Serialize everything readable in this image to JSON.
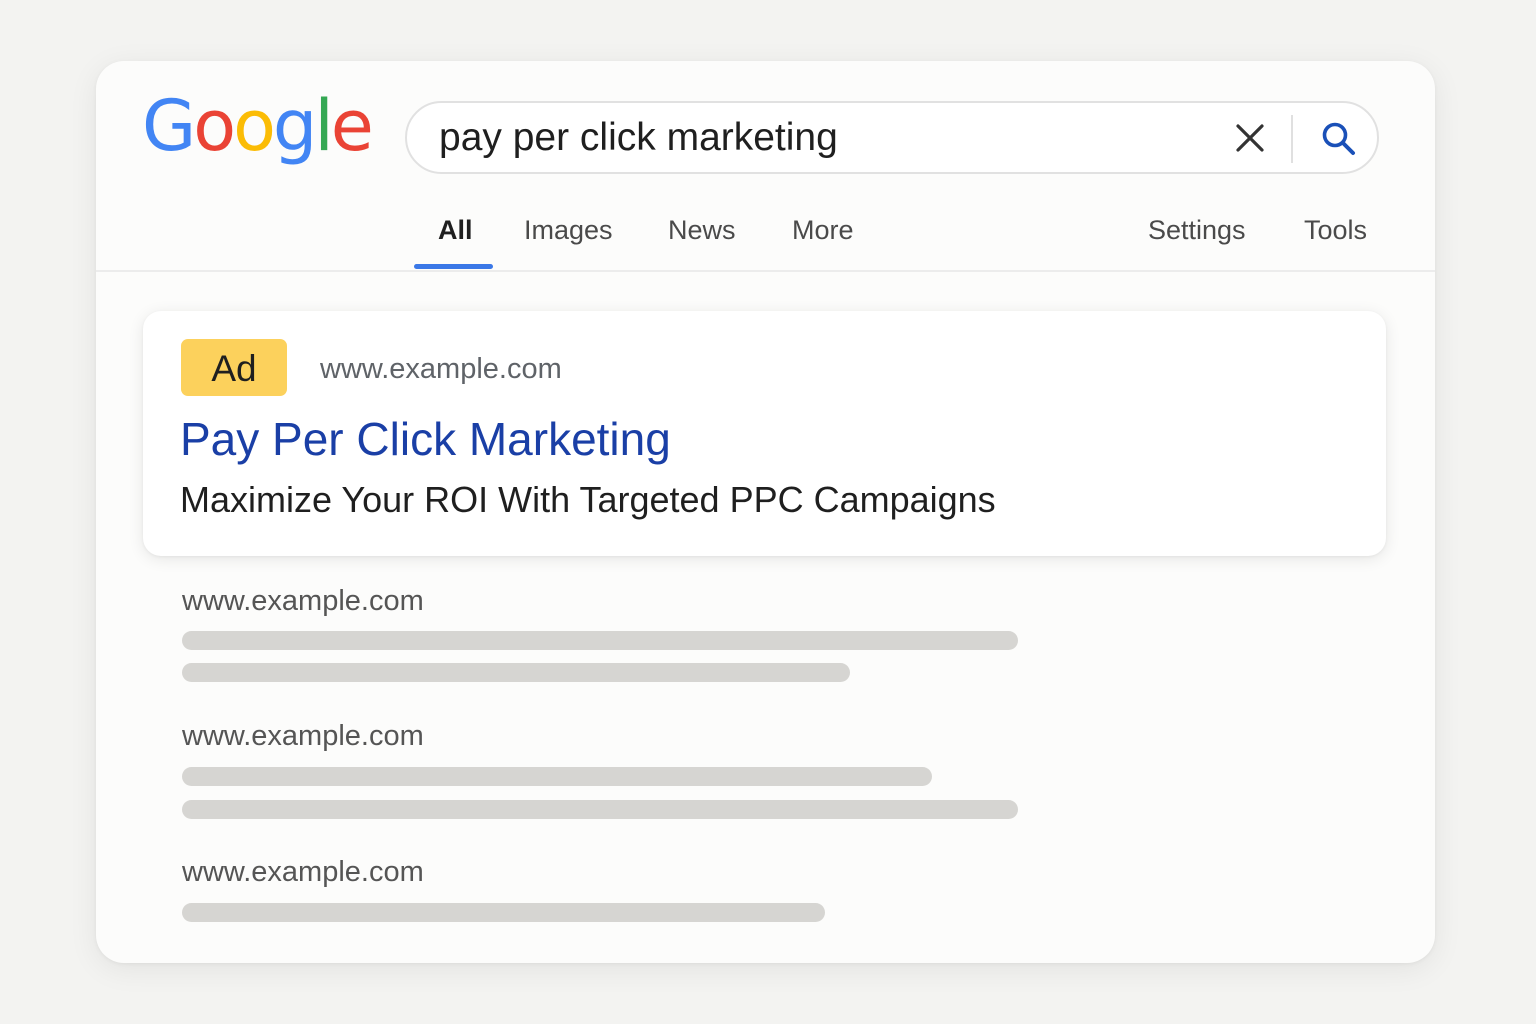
{
  "logo": {
    "letters": [
      "G",
      "o",
      "o",
      "g",
      "l",
      "e"
    ],
    "colors": [
      "#4285F4",
      "#EA4335",
      "#FBBC05",
      "#4285F4",
      "#34A853",
      "#EA4335"
    ]
  },
  "search": {
    "query": "pay per click marketing",
    "clear_icon": "close-icon",
    "search_icon": "search-icon",
    "accent_color": "#1a50b8"
  },
  "tabs": {
    "all": "All",
    "images": "Images",
    "news": "News",
    "more": "More",
    "settings": "Settings",
    "tools": "Tools",
    "active": "All",
    "active_color": "#3b78e7"
  },
  "ad": {
    "badge": "Ad",
    "badge_color": "#fcd15c",
    "url": "www.example.com",
    "title": "Pay Per Click Marketing",
    "title_color": "#1a3fa6",
    "description": "Maximize Your ROI With Targeted PPC Campaigns"
  },
  "results": [
    {
      "url": "www.example.com"
    },
    {
      "url": "www.example.com"
    },
    {
      "url": "www.example.com"
    }
  ]
}
